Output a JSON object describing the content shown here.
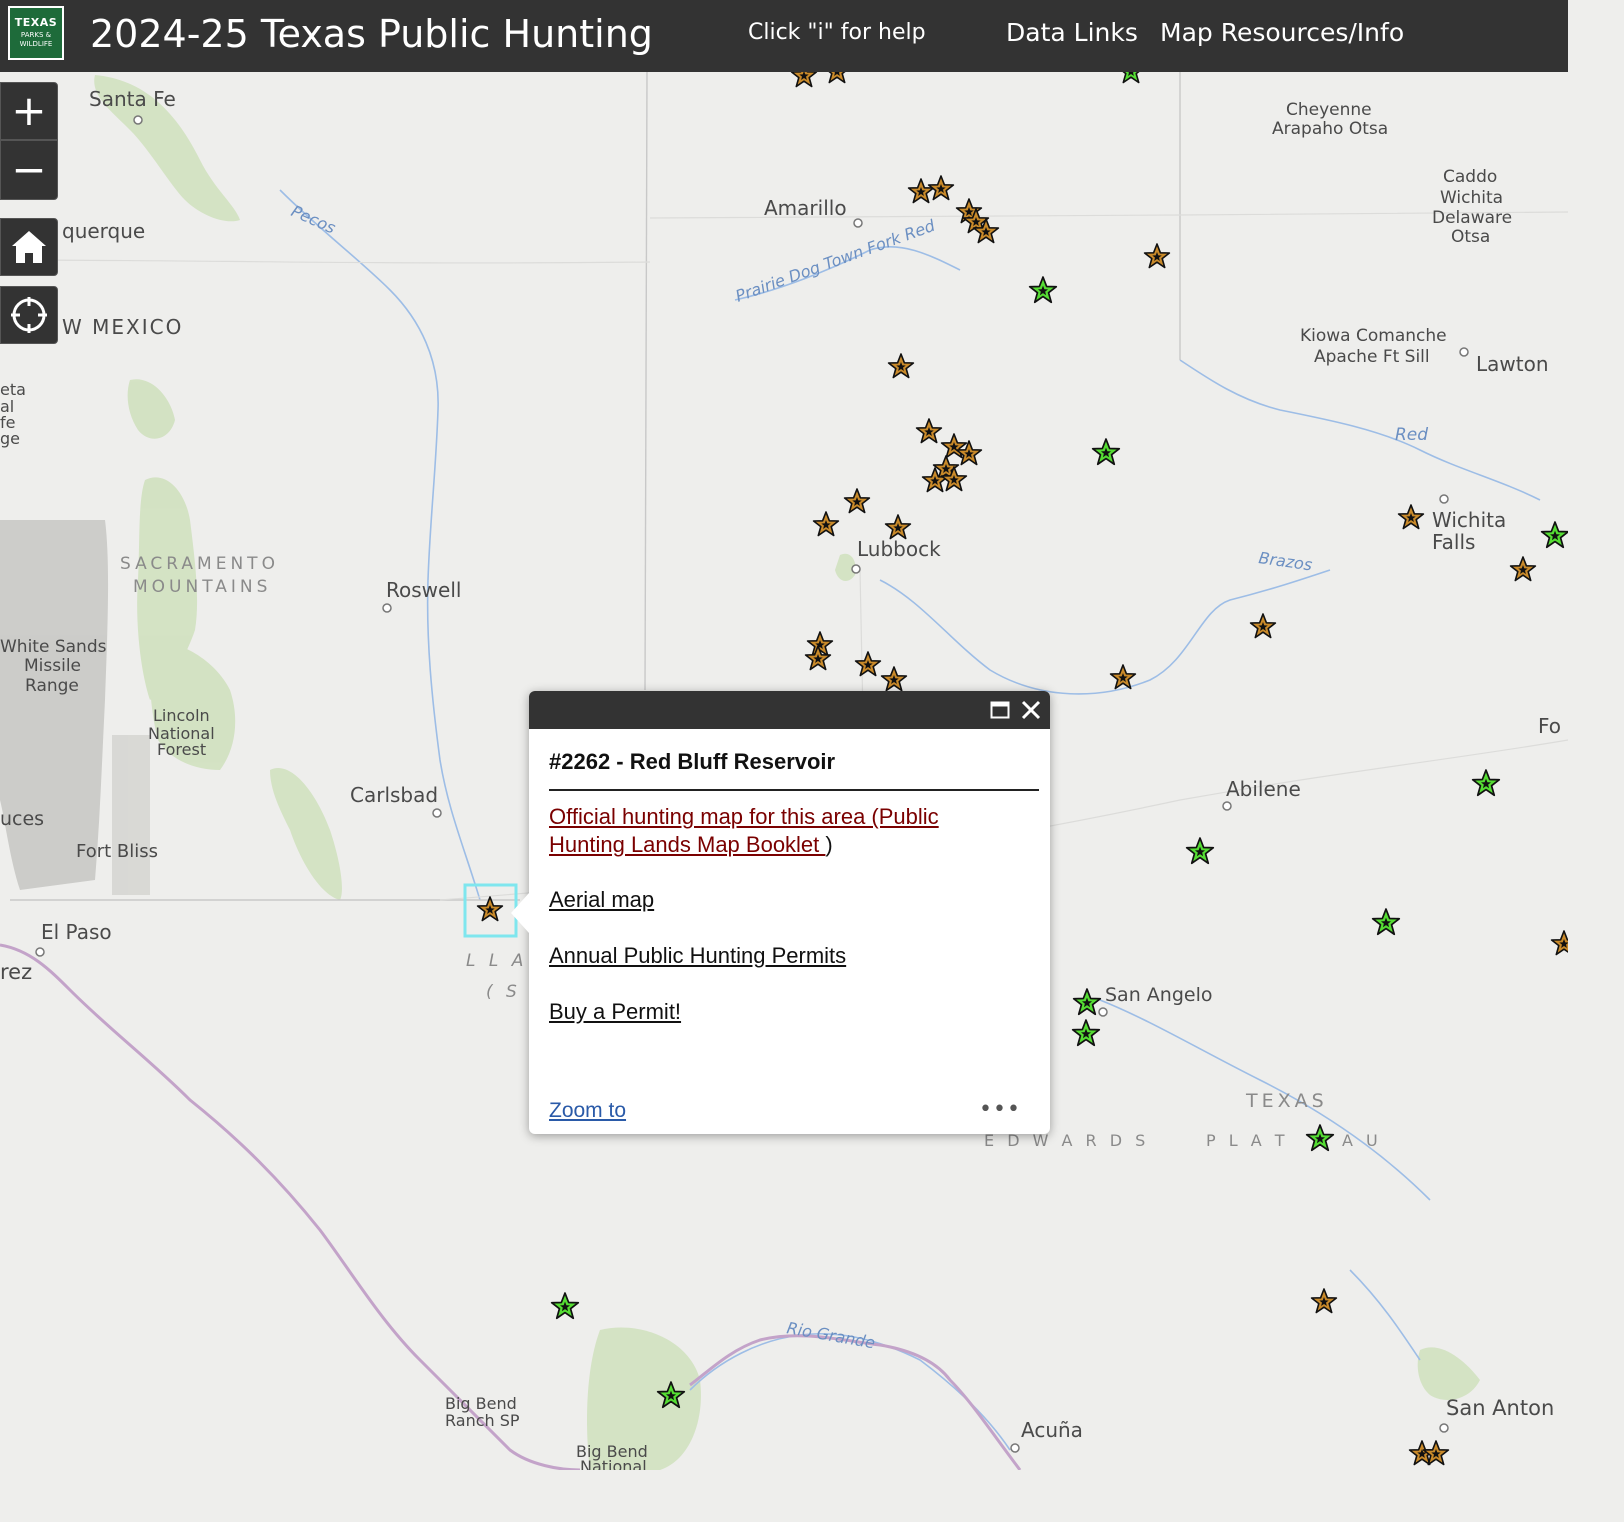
{
  "header": {
    "logo": {
      "line1": "TEXAS",
      "line2": "PARKS &",
      "line3": "WILDLIFE"
    },
    "title": "2024-25 Texas Public Hunting",
    "help_hint": "Click \"i\" for help",
    "nav": {
      "data_links": "Data Links",
      "map_resources": "Map Resources/Info"
    }
  },
  "controls": {
    "zoom_in": "+",
    "zoom_out": "−"
  },
  "map_labels": {
    "santa_fe": "Santa Fe",
    "albuquerque": "querque",
    "new_mexico": "W MEXICO",
    "pecos": "Pecos",
    "amarillo": "Amarillo",
    "prairie_dog": "Prairie Dog Town Fork Red",
    "cheyenne_1": "Cheyenne",
    "cheyenne_2": "Arapaho Otsa",
    "caddo_1": "Caddo",
    "caddo_2": "Wichita",
    "caddo_3": "Delaware",
    "caddo_4": "Otsa",
    "kiowa_1": "Kiowa Comanche",
    "kiowa_2": "Apache Ft Sill",
    "lawton": "Lawton",
    "red": "Red",
    "wichita_falls_1": "Wichita",
    "wichita_falls_2": "Falls",
    "brazos": "Brazos",
    "lubbock": "Lubbock",
    "roswell": "Roswell",
    "sacramento_1": "SACRAMENTO",
    "sacramento_2": "MOUNTAINS",
    "white_sands_1": "White Sands",
    "white_sands_2": "Missile",
    "white_sands_3": "Range",
    "lincoln_1": "Lincoln",
    "lincoln_2": "National",
    "lincoln_3": "Forest",
    "carlsbad": "Carlsbad",
    "cruces": "uces",
    "fort_bliss": "Fort Bliss",
    "el_paso": "El Paso",
    "juarez": "rez",
    "llano_1": "L L A",
    "llano_2": "( S",
    "abilene": "Abilene",
    "san_angelo": "San Angelo",
    "texas": "TEXAS",
    "edwards_1": "E D W A R D S",
    "edwards_2": "P L A T",
    "edwards_3": "A U",
    "rio_grande": "Rio Grande",
    "big_bend_ranch_1": "Big Bend",
    "big_bend_ranch_2": "Ranch SP",
    "big_bend_np_1": "Big Bend",
    "big_bend_np_2": "National",
    "acuna": "Acuña",
    "san_antonio": "San Anton",
    "fo": "Fo",
    "left_edge": [
      "eta",
      "al",
      "fe",
      "ge"
    ]
  },
  "popup": {
    "title": "#2262 - Red Bluff Reservoir",
    "official_map_link": "Official hunting map for this area (Public Hunting Lands Map Booklet ",
    "official_map_paren": ")",
    "aerial_map_link": "Aerial map",
    "annual_permits_link": "Annual Public Hunting Permits",
    "buy_permit_link": "Buy a Permit!",
    "zoom_to": "Zoom to",
    "more": "•••"
  },
  "colors": {
    "header_bg": "#333333",
    "orange_star": "#c98a2a",
    "green_star": "#55dd33",
    "highlight": "#7fe6ee"
  }
}
